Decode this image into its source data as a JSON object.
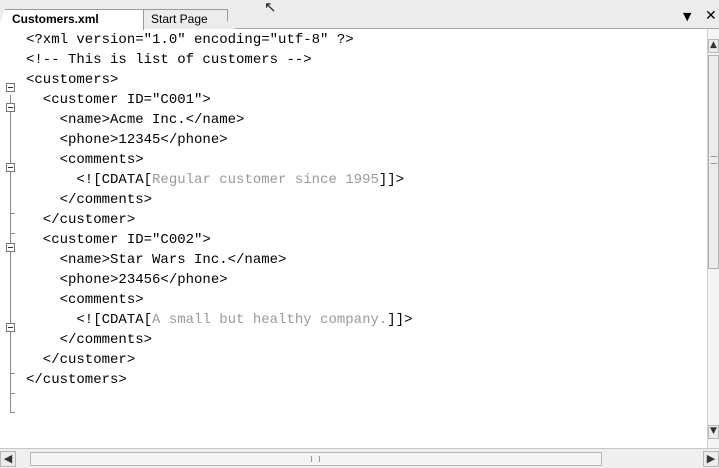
{
  "tabs": {
    "active": "Customers.xml",
    "inactive": "Start Page"
  },
  "icons": {
    "dropdown": "chevron-down-icon",
    "close": "close-icon",
    "cursor": "mouse-cursor-icon",
    "scroll_up": "arrow-up-icon",
    "scroll_down": "arrow-down-icon",
    "scroll_left": "arrow-left-icon",
    "scroll_right": "arrow-right-icon"
  },
  "colors": {
    "text": "#000000",
    "cdata": "#9a9a9a",
    "tab_strip": "#ececec"
  },
  "editor": {
    "lines": [
      [
        {
          "t": "<?xml version=\"1.0\" encoding=\"utf-8\" ?>",
          "c": false
        }
      ],
      [
        {
          "t": "<!-- This is list of customers -->",
          "c": false
        }
      ],
      [
        {
          "t": "<customers>",
          "c": false
        }
      ],
      [
        {
          "t": "  <customer ID=\"C001\">",
          "c": false
        }
      ],
      [
        {
          "t": "    <name>Acme Inc.</name>",
          "c": false
        }
      ],
      [
        {
          "t": "    <phone>12345</phone>",
          "c": false
        }
      ],
      [
        {
          "t": "    <comments>",
          "c": false
        }
      ],
      [
        {
          "t": "      <![CDATA[",
          "c": false
        },
        {
          "t": "Regular customer since 1995",
          "c": true
        },
        {
          "t": "]]>",
          "c": false
        }
      ],
      [
        {
          "t": "    </comments>",
          "c": false
        }
      ],
      [
        {
          "t": "  </customer>",
          "c": false
        }
      ],
      [
        {
          "t": "  <customer ID=\"C002\">",
          "c": false
        }
      ],
      [
        {
          "t": "    <name>Star Wars Inc.</name>",
          "c": false
        }
      ],
      [
        {
          "t": "    <phone>23456</phone>",
          "c": false
        }
      ],
      [
        {
          "t": "    <comments>",
          "c": false
        }
      ],
      [
        {
          "t": "      <![CDATA[",
          "c": false
        },
        {
          "t": "A small but healthy company.",
          "c": true
        },
        {
          "t": "]]>",
          "c": false
        }
      ],
      [
        {
          "t": "    </comments>",
          "c": false
        }
      ],
      [
        {
          "t": "  </customer>",
          "c": false
        }
      ],
      [
        {
          "t": "</customers>",
          "c": false
        }
      ]
    ]
  }
}
